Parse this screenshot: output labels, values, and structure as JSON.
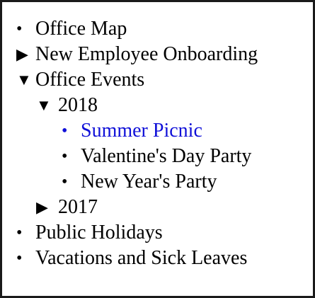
{
  "tree": {
    "items": [
      {
        "label": "Office Map",
        "marker": "•",
        "level": 0
      },
      {
        "label": "New Employee Onboarding",
        "marker": "▶",
        "level": 0,
        "state": "collapsed"
      },
      {
        "label": "Office Events",
        "marker": "▼",
        "level": 0,
        "state": "expanded"
      },
      {
        "label": "2018",
        "marker": "▼",
        "level": 1,
        "state": "expanded"
      },
      {
        "label": "Summer Picnic",
        "marker": "•",
        "level": 2,
        "state": "selected"
      },
      {
        "label": "Valentine's Day Party",
        "marker": "•",
        "level": 2
      },
      {
        "label": "New Year's Party",
        "marker": "•",
        "level": 2
      },
      {
        "label": "2017",
        "marker": "▶",
        "level": 1,
        "state": "collapsed"
      },
      {
        "label": "Public Holidays",
        "marker": "•",
        "level": 0
      },
      {
        "label": "Vacations and Sick Leaves",
        "marker": "•",
        "level": 0
      }
    ]
  },
  "colors": {
    "selected_text": "#1010d8",
    "text": "#000000",
    "border": "#1a1a1a",
    "background": "#ffffff"
  }
}
